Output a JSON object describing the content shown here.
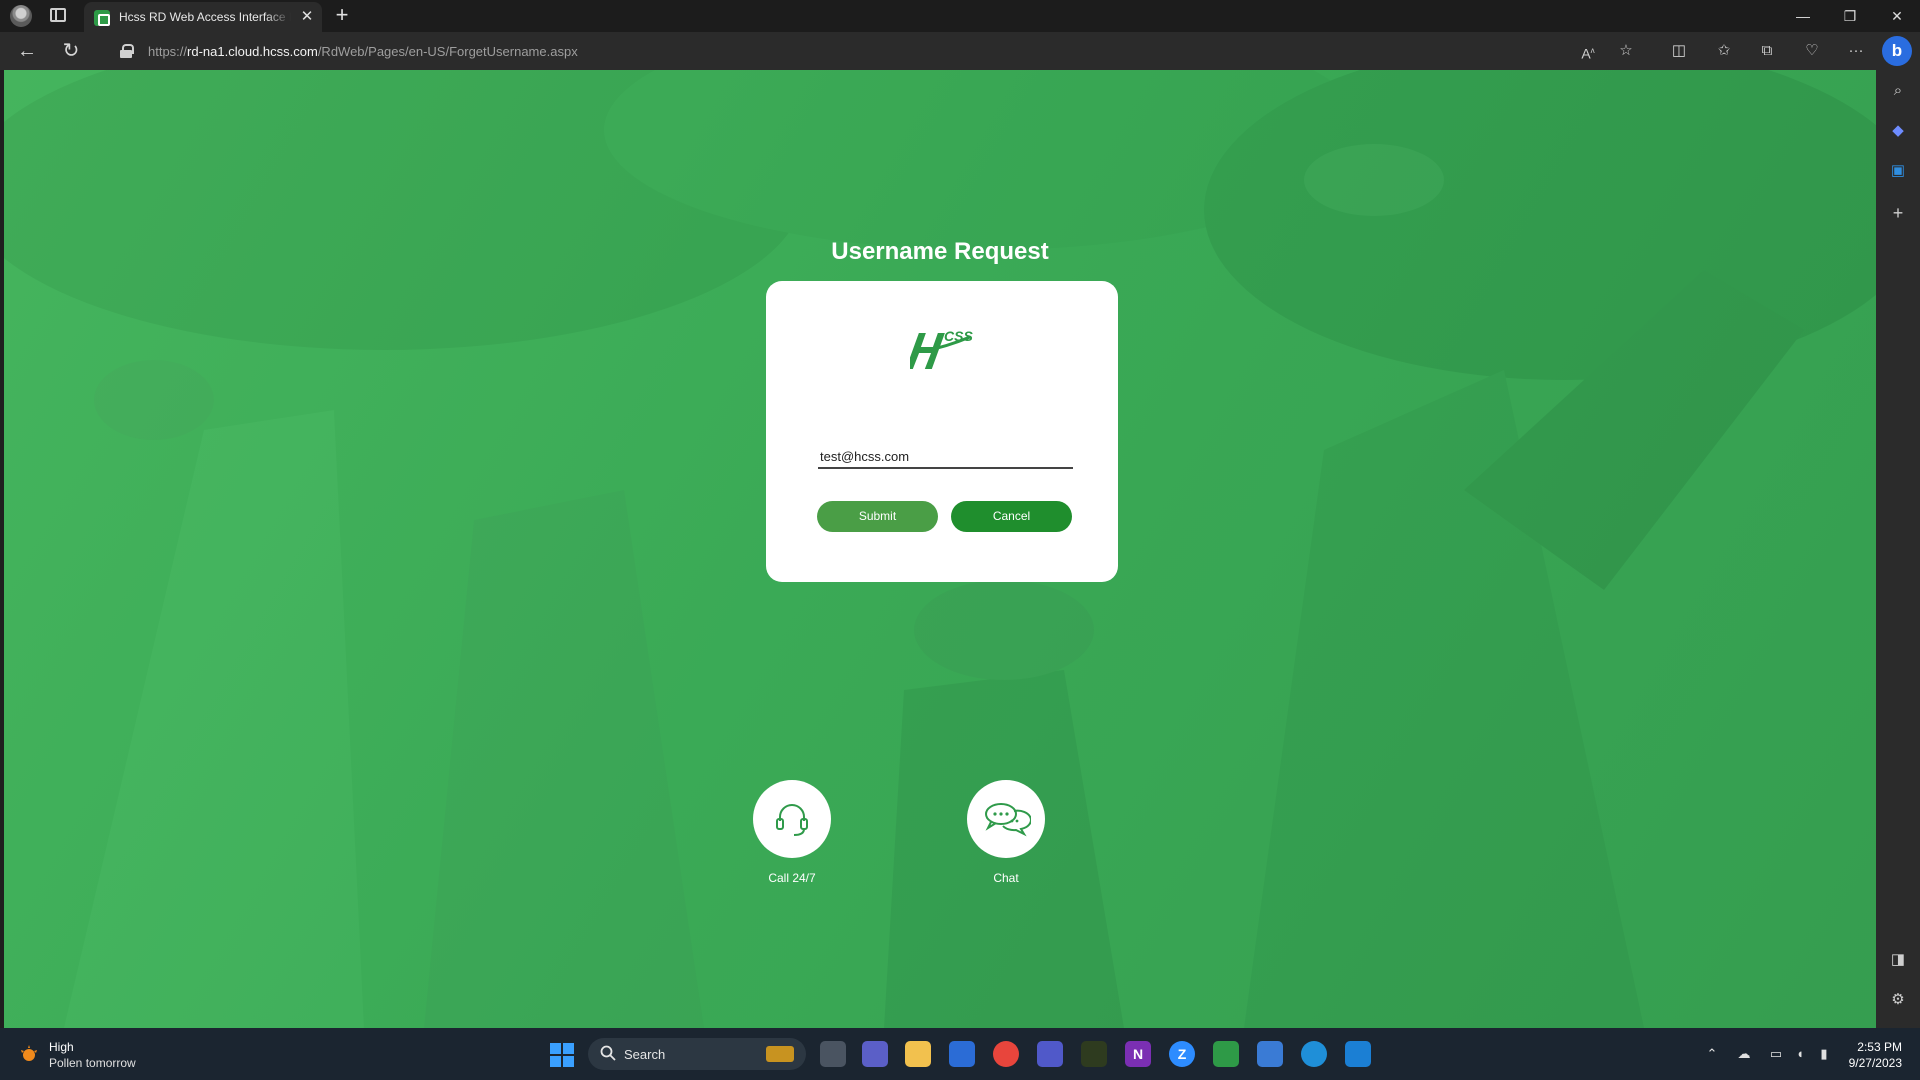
{
  "browser": {
    "tab_title": "Hcss RD Web Access Interface De",
    "tab_close_glyph": "✕",
    "new_tab_glyph": "+",
    "url_host": "rd-na1.cloud.hcss.com",
    "url_scheme": "https://",
    "url_path": "/RdWeb/Pages/en-US/ForgetUsername.aspx",
    "back_glyph": "←",
    "refresh_glyph": "↻",
    "window_controls": {
      "minimize": "—",
      "restore": "❐",
      "close": "✕"
    },
    "bing_label": "b",
    "icons": [
      "read-aloud-icon",
      "favorite-star-icon",
      "split-screen-icon",
      "favorites-icon",
      "collections-icon",
      "browser-essentials-icon",
      "more-menu-icon",
      "bing-chat-icon"
    ]
  },
  "sidebar": {
    "icons": [
      "search-icon",
      "copilot-icon",
      "outlook-icon",
      "add-icon",
      "hide-sidebar-icon",
      "settings-icon"
    ]
  },
  "page": {
    "heading": "Username Request",
    "email_value": "test@hcss.com",
    "submit_label": "Submit",
    "cancel_label": "Cancel",
    "support": {
      "call_label": "Call 24/7",
      "chat_label": "Chat"
    }
  },
  "taskbar": {
    "weather_title": "High",
    "weather_subtitle": "Pollen tomorrow",
    "search_label": "Search",
    "clock_time": "2:53 PM",
    "clock_date": "9/27/2023",
    "apps": [
      "task-view-icon",
      "meet-icon",
      "file-explorer-icon",
      "store-icon",
      "chrome-icon",
      "teams-icon",
      "cad-app-icon",
      "onenote-icon",
      "zoom-icon",
      "hcss-app-icon",
      "notepad-icon",
      "edge-icon",
      "remote-desktop-icon"
    ]
  },
  "colors": {
    "brand_green": "#2e9a47",
    "submit_green": "#4a9e46",
    "cancel_green": "#1f8e2d"
  }
}
